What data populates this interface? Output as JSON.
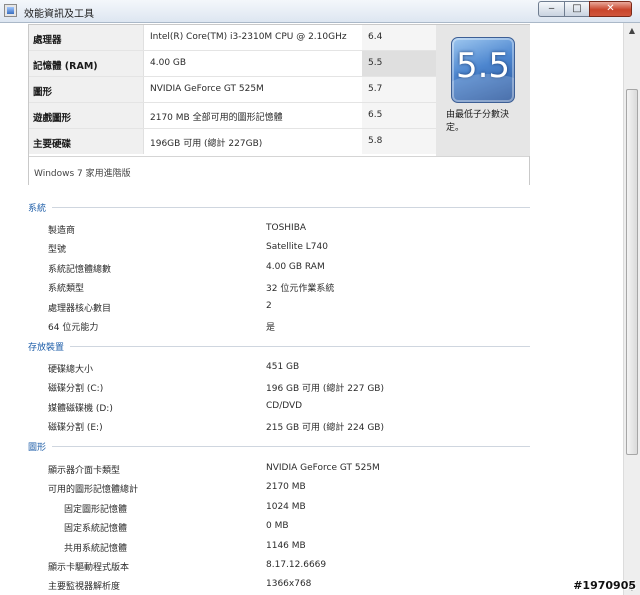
{
  "window": {
    "title": "效能資訊及工具",
    "min_glyph": "‒",
    "max_glyph": "□",
    "close_glyph": "✕"
  },
  "scrollbar": {
    "up_glyph": "▲",
    "down_glyph": "▼"
  },
  "scores": {
    "rows": [
      {
        "component": "處理器",
        "detail": "Intel(R) Core(TM) i3-2310M CPU @ 2.10GHz",
        "subscore": "6.4"
      },
      {
        "component": "記憶體 (RAM)",
        "detail": "4.00 GB",
        "subscore": "5.5"
      },
      {
        "component": "圖形",
        "detail": "NVIDIA GeForce GT 525M",
        "subscore": "5.7"
      },
      {
        "component": "遊戲圖形",
        "detail": "2170 MB 全部可用的圖形記憶體",
        "subscore": "6.5"
      },
      {
        "component": "主要硬碟",
        "detail": "196GB 可用 (總計 227GB)",
        "subscore": "5.8"
      }
    ],
    "base_score": "5.5",
    "base_caption": "由最低子分數決定。",
    "edition": "Windows 7 家用進階版"
  },
  "system": {
    "heading": "系統",
    "items": [
      {
        "label": "製造商",
        "value": "TOSHIBA"
      },
      {
        "label": "型號",
        "value": "Satellite L740"
      },
      {
        "label": "系統記憶體總數",
        "value": "4.00 GB RAM"
      },
      {
        "label": "系統類型",
        "value": "32 位元作業系統"
      },
      {
        "label": "處理器核心數目",
        "value": "2"
      },
      {
        "label": "64 位元能力",
        "value": "是"
      }
    ]
  },
  "storage": {
    "heading": "存放裝置",
    "items": [
      {
        "label": "硬碟總大小",
        "value": "451 GB"
      },
      {
        "label": "磁碟分割 (C:)",
        "value": "196 GB 可用 (總計 227 GB)"
      },
      {
        "label": "媒體磁碟機 (D:)",
        "value": "CD/DVD"
      },
      {
        "label": "磁碟分割 (E:)",
        "value": "215 GB 可用 (總計 224 GB)"
      }
    ]
  },
  "graphics": {
    "heading": "圖形",
    "items": [
      {
        "label": "顯示器介面卡類型",
        "value": "NVIDIA GeForce GT 525M"
      },
      {
        "label": "可用的圖形記憶體總計",
        "value": "2170 MB"
      },
      {
        "label": "固定圖形記憶體",
        "value": "1024 MB"
      },
      {
        "label": "固定系統記憶體",
        "value": "0 MB"
      },
      {
        "label": "共用系統記憶體",
        "value": "1146 MB"
      },
      {
        "label": "顯示卡驅動程式版本",
        "value": "8.17.12.6669"
      },
      {
        "label": "主要監視器解析度",
        "value": "1366x768"
      }
    ]
  },
  "watermark": "#1970905"
}
